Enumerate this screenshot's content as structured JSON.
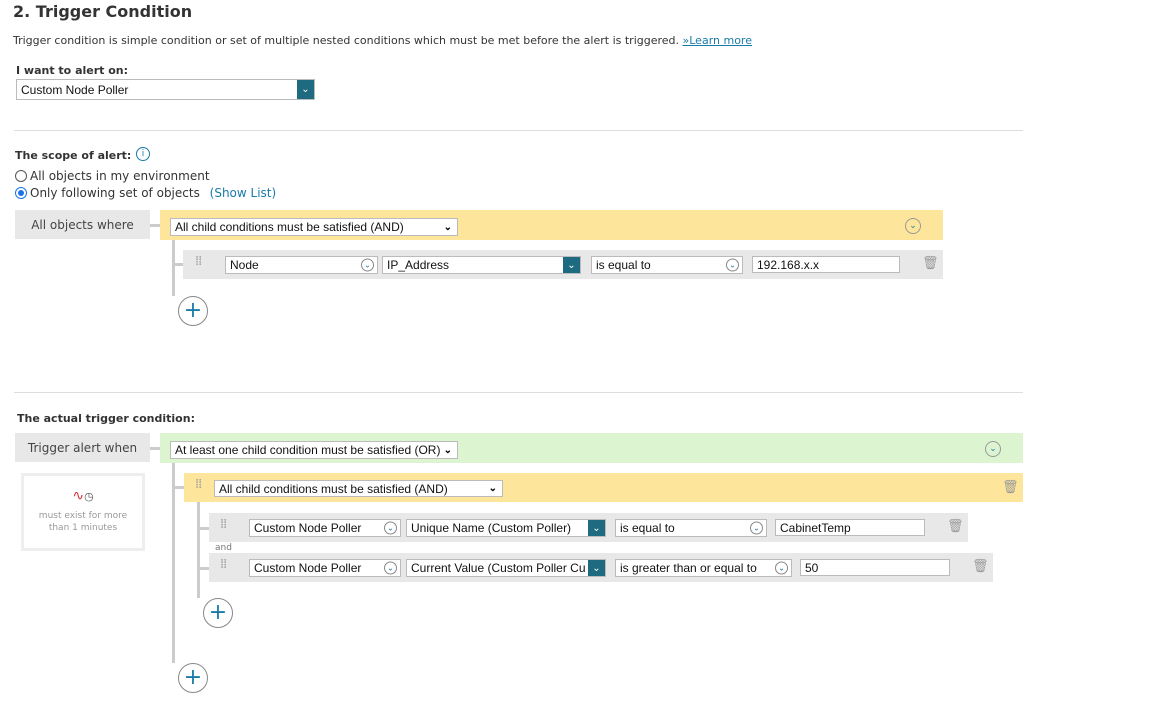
{
  "section_title": "2. Trigger Condition",
  "description": "Trigger condition is simple condition or set of multiple nested conditions which must be met before the alert is triggered. ",
  "learn_more": "»Learn more",
  "alert_on": {
    "label": "I want to alert on:",
    "value": "Custom Node Poller"
  },
  "scope": {
    "label": "The scope of alert:",
    "options": [
      "All objects in my environment",
      "Only following set of objects"
    ],
    "selected": 1,
    "show_list": "(Show List)",
    "where_label": "All objects where",
    "group_operator": "All child conditions must be satisfied (AND)",
    "condition": {
      "object": "Node",
      "field": "IP_Address",
      "operator": "is equal to",
      "value": "192.168.x.x"
    }
  },
  "trigger": {
    "label": "The actual trigger condition:",
    "when_label": "Trigger alert when",
    "duration_text": "must exist for more than 1 minutes",
    "group_operator": "At least one child condition must be satisfied (OR)",
    "subgroup_operator": "All child conditions must be satisfied (AND)",
    "joiner": "and",
    "conditions": [
      {
        "object": "Custom Node Poller",
        "field": "Unique Name (Custom Poller)",
        "operator": "is equal to",
        "value": "CabinetTemp"
      },
      {
        "object": "Custom Node Poller",
        "field": "Current Value (Custom Poller Cu",
        "operator": "is greater than or equal to",
        "value": "50"
      }
    ]
  },
  "colors": {
    "teal": "#1e6a80",
    "yellow": "#fde69c",
    "green": "#dcf5d0",
    "link": "#1a7ba8"
  }
}
